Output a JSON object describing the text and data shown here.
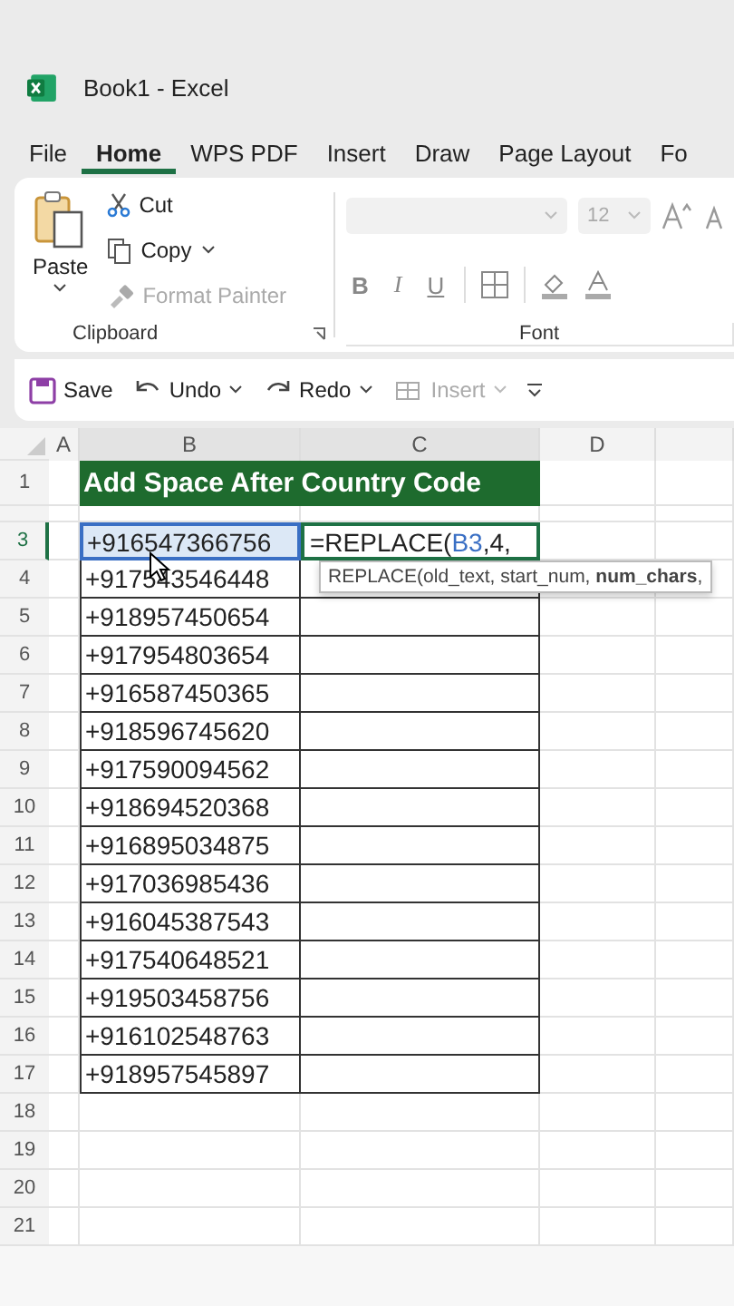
{
  "window": {
    "title": "Book1  -  Excel"
  },
  "tabs": [
    {
      "label": "File",
      "selected": false
    },
    {
      "label": "Home",
      "selected": true
    },
    {
      "label": "WPS PDF",
      "selected": false
    },
    {
      "label": "Insert",
      "selected": false
    },
    {
      "label": "Draw",
      "selected": false
    },
    {
      "label": "Page Layout",
      "selected": false
    },
    {
      "label": "Fo",
      "selected": false
    }
  ],
  "clipboard": {
    "label": "Clipboard",
    "paste": "Paste",
    "cut": "Cut",
    "copy": "Copy",
    "format_painter": {
      "label": "Format Painter",
      "disabled": true
    }
  },
  "font": {
    "label": "Font",
    "size": "12",
    "bold": "B",
    "italic": "I",
    "underline": "U"
  },
  "quick_access": [
    {
      "label": "Save",
      "kind": "save",
      "disabled": false
    },
    {
      "label": "Undo",
      "kind": "undo",
      "disabled": false
    },
    {
      "label": "Redo",
      "kind": "redo",
      "disabled": false
    },
    {
      "label": "Insert",
      "kind": "insert",
      "disabled": true
    }
  ],
  "sheet": {
    "columns": [
      "A",
      "B",
      "C",
      "D"
    ],
    "title": "Add Space After Country Code",
    "formula": {
      "prefix": "=REPLACE(",
      "ref": "B3",
      "suffix": ",4,"
    },
    "tooltip": "REPLACE(old_text, start_num, **num_chars**,",
    "rows": [
      {
        "number": "3",
        "value": "+916547366756",
        "selected": true
      },
      {
        "number": "4",
        "value": "+917543546448",
        "selected": false
      },
      {
        "number": "5",
        "value": "+918957450654",
        "selected": false
      },
      {
        "number": "6",
        "value": "+917954803654",
        "selected": false
      },
      {
        "number": "7",
        "value": "+916587450365",
        "selected": false
      },
      {
        "number": "8",
        "value": "+918596745620",
        "selected": false
      },
      {
        "number": "9",
        "value": "+917590094562",
        "selected": false
      },
      {
        "number": "10",
        "value": "+918694520368",
        "selected": false
      },
      {
        "number": "11",
        "value": "+916895034875",
        "selected": false
      },
      {
        "number": "12",
        "value": "+917036985436",
        "selected": false
      },
      {
        "number": "13",
        "value": "+916045387543",
        "selected": false
      },
      {
        "number": "14",
        "value": "+917540648521",
        "selected": false
      },
      {
        "number": "15",
        "value": "+919503458756",
        "selected": false
      },
      {
        "number": "16",
        "value": "+916102548763",
        "selected": false
      },
      {
        "number": "17",
        "value": "+918957545897",
        "selected": false
      }
    ],
    "empty_rows": [
      "18",
      "19",
      "20",
      "21"
    ],
    "title_row": "1"
  }
}
